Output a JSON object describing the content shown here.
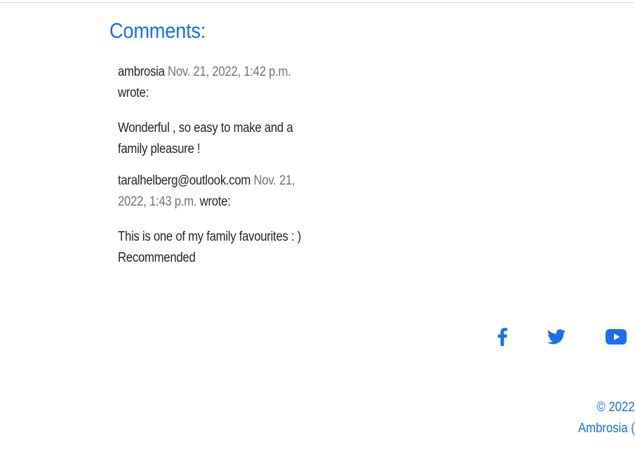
{
  "comments_section": {
    "title": "Comments:",
    "comments": [
      {
        "author": "ambrosia",
        "date": "Nov. 21, 2022, 1:42 p.m.",
        "wrote_label": "wrote:",
        "body": "Wonderful , so easy to make and a family pleasure !"
      },
      {
        "author": "taralhelberg@outlook.com",
        "date": "Nov. 21, 2022, 1:43 p.m.",
        "wrote_label": "wrote:",
        "body": "This is one of my family favourites : ) Recommended"
      }
    ]
  },
  "social": {
    "icons": [
      "facebook-icon",
      "twitter-icon",
      "youtube-icon"
    ],
    "color": "#1a6ef0"
  },
  "footer": {
    "copyright_line": "© 2022",
    "brand_line": "Ambrosia ("
  },
  "colors": {
    "accent": "#1a6ef0",
    "muted_date": "#6c757d",
    "text": "#212529"
  }
}
